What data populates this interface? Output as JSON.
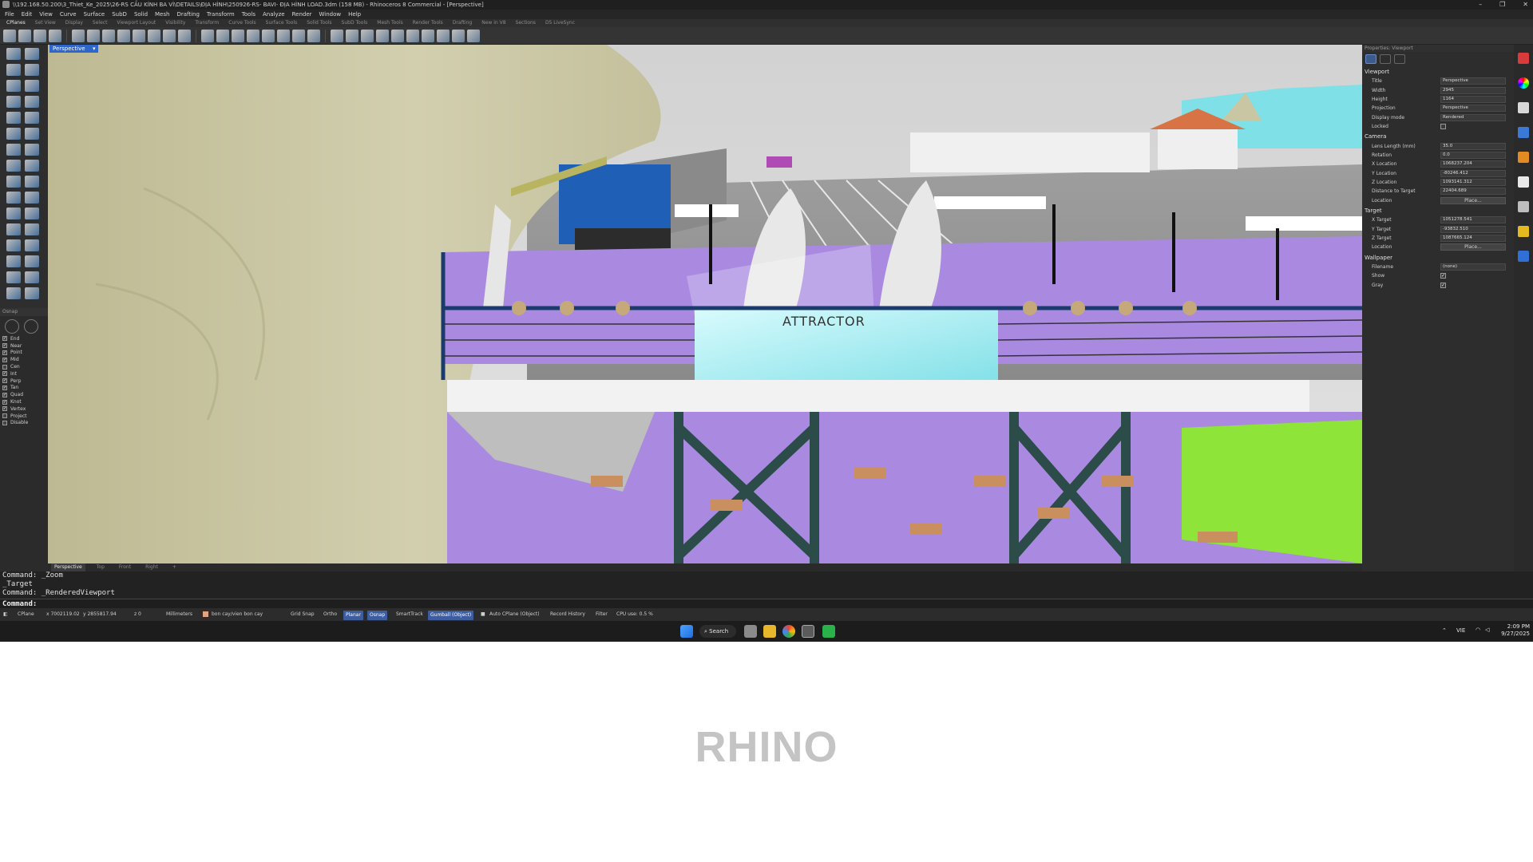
{
  "window": {
    "title": "\\\\192.168.50.200\\3_Thiet_Ke_2025\\26-RS CẦU KÍNH BA VÌ\\DETAILS\\ĐỊA HÌNH\\250926-RS- BAVI- ĐỊA HÌNH LOAD.3dm (158 MB) - Rhinoceros 8 Commercial - [Perspective]",
    "controls": [
      "–",
      "❐",
      "✕"
    ]
  },
  "menu": [
    "File",
    "Edit",
    "View",
    "Curve",
    "Surface",
    "SubD",
    "Solid",
    "Mesh",
    "Drafting",
    "Transform",
    "Tools",
    "Analyze",
    "Render",
    "Window",
    "Help"
  ],
  "toolbar_tabs": [
    "CPlanes",
    "Set View",
    "Display",
    "Select",
    "Viewport Layout",
    "Visibility",
    "Transform",
    "Curve Tools",
    "Surface Tools",
    "Solid Tools",
    "SubD Tools",
    "Mesh Tools",
    "Render Tools",
    "Drafting",
    "New in V8",
    "Sections",
    "D5 LiveSync"
  ],
  "viewport": {
    "active_label": "Perspective",
    "scene_sign": "ATTRACTOR",
    "tabs": [
      "Perspective",
      "Top",
      "Front",
      "Right",
      "+"
    ]
  },
  "osnap": {
    "header": "Osnap",
    "items": [
      {
        "label": "End",
        "checked": true
      },
      {
        "label": "Near",
        "checked": true
      },
      {
        "label": "Point",
        "checked": true
      },
      {
        "label": "Mid",
        "checked": true
      },
      {
        "label": "Cen",
        "checked": false
      },
      {
        "label": "Int",
        "checked": true
      },
      {
        "label": "Perp",
        "checked": true
      },
      {
        "label": "Tan",
        "checked": true
      },
      {
        "label": "Quad",
        "checked": true
      },
      {
        "label": "Knot",
        "checked": true
      },
      {
        "label": "Vertex",
        "checked": true
      },
      {
        "label": "Project",
        "checked": false
      },
      {
        "label": "Disable",
        "checked": false
      }
    ]
  },
  "properties": {
    "title": "Properties: Viewport",
    "viewport_section": "Viewport",
    "viewport_rows": [
      {
        "k": "Title",
        "v": "Perspective"
      },
      {
        "k": "Width",
        "v": "2945"
      },
      {
        "k": "Height",
        "v": "1164"
      },
      {
        "k": "Projection",
        "v": "Perspective"
      },
      {
        "k": "Display mode",
        "v": "Rendered"
      }
    ],
    "locked_label": "Locked",
    "camera_section": "Camera",
    "camera_rows": [
      {
        "k": "Lens Length (mm)",
        "v": "35.0"
      },
      {
        "k": "Rotation",
        "v": "0.0"
      },
      {
        "k": "X Location",
        "v": "1068237.204"
      },
      {
        "k": "Y Location",
        "v": "-80246.412"
      },
      {
        "k": "Z Location",
        "v": "1093141.312"
      },
      {
        "k": "Distance to Target",
        "v": "22404.689"
      }
    ],
    "location_label": "Location",
    "place_label": "Place...",
    "target_section": "Target",
    "target_rows": [
      {
        "k": "X Target",
        "v": "1051278.541"
      },
      {
        "k": "Y Target",
        "v": "-93832.510"
      },
      {
        "k": "Z Target",
        "v": "1087665.124"
      }
    ],
    "wallpaper_section": "Wallpaper",
    "filename_label": "Filename",
    "filename_value": "(none)",
    "show_label": "Show",
    "gray_label": "Gray"
  },
  "command": {
    "history": [
      "Command: _Zoom",
      "_Target",
      "Command: _RenderedViewport"
    ],
    "prompt": "Command:"
  },
  "status": {
    "cplane": "CPlane",
    "x": "x 7002119.02",
    "y": "y 2855817.94",
    "z": "z 0",
    "units": "Millimeters",
    "layer": "bon cay/vien bon cay",
    "grid_snap": "Grid Snap",
    "ortho": "Ortho",
    "planar": "Planar",
    "osnap": "Osnap",
    "smarttrack": "SmartTrack",
    "gumball": "Gumball (Object)",
    "auto_cplane": "Auto CPlane (Object)",
    "record_history": "Record History",
    "filter": "Filter",
    "cpu": "CPU use: 0.5 %"
  },
  "taskbar": {
    "search": "Search",
    "lang": "VIE",
    "time": "2:09 PM",
    "date": "9/27/2025"
  },
  "caption": "RHINO",
  "colors": {
    "floor": "#a98ae0",
    "glass": "#8fe8ee",
    "terrain": "#c9c6a4",
    "green_wall": "#8fe43a",
    "frame": "#2b4c48"
  }
}
